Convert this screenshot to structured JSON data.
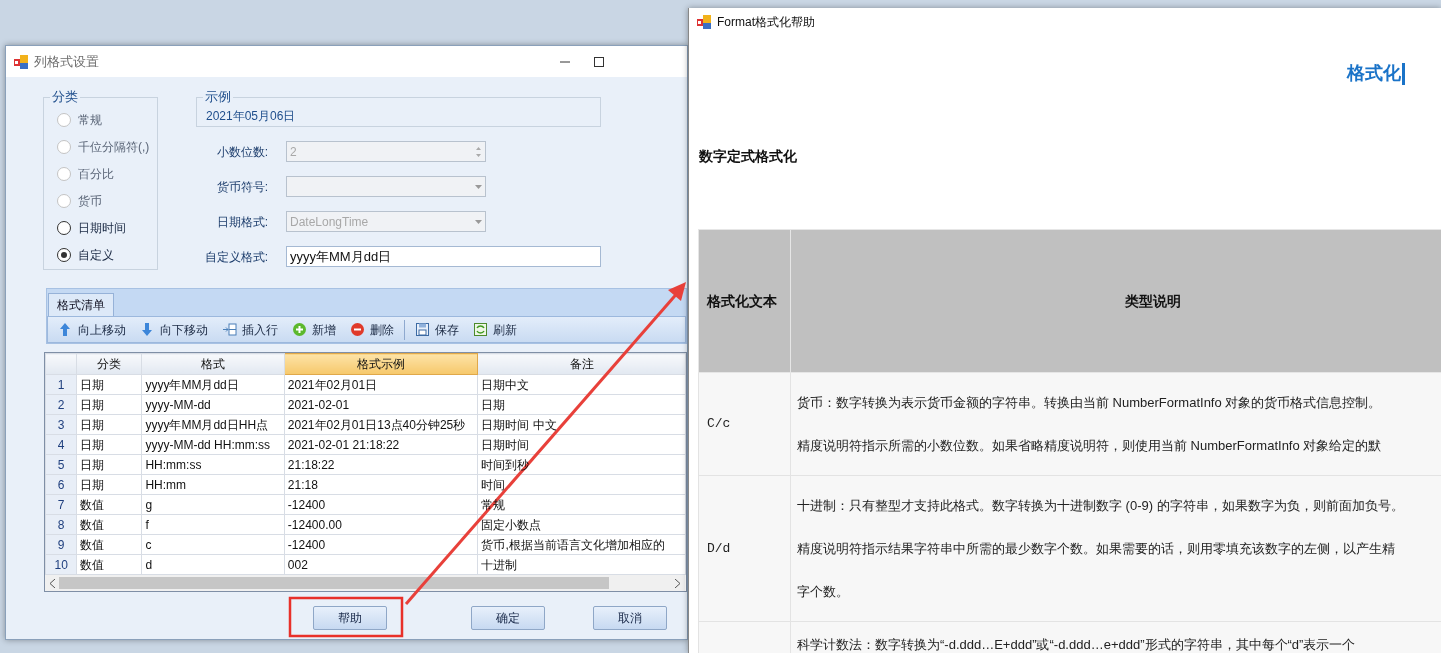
{
  "dialog": {
    "title": "列格式设置",
    "category_group": {
      "label": "分类",
      "options": [
        {
          "label": "常规",
          "selected": false,
          "disabled": true
        },
        {
          "label": "千位分隔符(,)",
          "selected": false,
          "disabled": true
        },
        {
          "label": "百分比",
          "selected": false,
          "disabled": true
        },
        {
          "label": "货币",
          "selected": false,
          "disabled": true
        },
        {
          "label": "日期时间",
          "selected": false,
          "disabled": false
        },
        {
          "label": "自定义",
          "selected": true,
          "disabled": false
        }
      ]
    },
    "example": {
      "label": "示例",
      "value": "2021年05月06日"
    },
    "fields": [
      {
        "kind": "spinner",
        "label": "小数位数:",
        "value": "2",
        "disabled": true
      },
      {
        "kind": "dropdown",
        "label": "货币符号:",
        "disabled": true
      },
      {
        "kind": "dropdown",
        "label": "日期格式:",
        "value": "DateLongTime",
        "disabled": true
      },
      {
        "kind": "text",
        "label": "自定义格式:",
        "value": "yyyy年MM月dd日",
        "disabled": false
      }
    ],
    "tabs": [
      {
        "label": "格式清单",
        "selected": true
      }
    ],
    "toolbar": [
      {
        "kind": "move-up",
        "label": "向上移动",
        "separator_before": false
      },
      {
        "kind": "move-down",
        "label": "向下移动",
        "separator_before": false
      },
      {
        "kind": "insert",
        "label": "插入行",
        "separator_before": false
      },
      {
        "kind": "add",
        "label": "新增",
        "separator_before": false
      },
      {
        "kind": "delete",
        "label": "删除",
        "separator_before": false
      },
      {
        "kind": "save",
        "label": "保存",
        "separator_before": true
      },
      {
        "kind": "refresh",
        "label": "刷新",
        "separator_before": false
      }
    ],
    "grid": {
      "columns": [
        {
          "label": "分类",
          "selected": false
        },
        {
          "label": "格式",
          "selected": false
        },
        {
          "label": "格式示例",
          "selected": true
        },
        {
          "label": "备注",
          "selected": false
        }
      ],
      "rows": [
        {
          "number": "1",
          "cells": [
            "日期",
            "yyyy年MM月dd日",
            "2021年02月01日",
            "日期中文"
          ]
        },
        {
          "number": "2",
          "cells": [
            "日期",
            "yyyy-MM-dd",
            "2021-02-01",
            "日期"
          ]
        },
        {
          "number": "3",
          "cells": [
            "日期",
            "yyyy年MM月dd日HH点",
            "2021年02月01日13点40分钟25秒",
            "日期时间 中文"
          ]
        },
        {
          "number": "4",
          "cells": [
            "日期",
            "yyyy-MM-dd HH:mm:ss",
            "2021-02-01 21:18:22",
            "日期时间"
          ]
        },
        {
          "number": "5",
          "cells": [
            "日期",
            "HH:mm:ss",
            "21:18:22",
            "时间到秒"
          ]
        },
        {
          "number": "6",
          "cells": [
            "日期",
            "HH:mm",
            "21:18",
            "时间"
          ]
        },
        {
          "number": "7",
          "cells": [
            "数值",
            "g",
            "-12400",
            "常规"
          ]
        },
        {
          "number": "8",
          "cells": [
            "数值",
            "f",
            "-12400.00",
            "固定小数点"
          ]
        },
        {
          "number": "9",
          "cells": [
            "数值",
            "c",
            "-12400",
            "货币,根据当前语言文化增加相应的"
          ]
        },
        {
          "number": "10",
          "cells": [
            "数值",
            "d",
            "002",
            "十进制"
          ]
        }
      ]
    },
    "buttons": [
      {
        "label": "帮助"
      },
      {
        "label": "确定"
      },
      {
        "label": "取消"
      }
    ]
  },
  "help_window": {
    "title": "Format格式化帮助",
    "heading": "格式化",
    "section_title": "数字定式格式化",
    "table": {
      "columns": [
        "格式化文本",
        "类型说明"
      ],
      "rows": [
        {
          "code": "C/c",
          "lines": [
            "货币：数字转换为表示货币金额的字符串。转换由当前 NumberFormatInfo 对象的货币格式信息控制。",
            "精度说明符指示所需的小数位数。如果省略精度说明符，则使用当前 NumberFormatInfo 对象给定的默"
          ]
        },
        {
          "code": "D/d",
          "lines": [
            "十进制：只有整型才支持此格式。数字转换为十进制数字 (0-9) 的字符串，如果数字为负，则前面加负号。",
            "精度说明符指示结果字符串中所需的最少数字个数。如果需要的话，则用零填充该数字的左侧，以产生精",
            "字个数。"
          ]
        },
        {
          "code": "",
          "lines": [
            "科学计数法：数字转换为“-d.ddd…E+ddd”或“-d.ddd…e+ddd”形式的字符串，其中每个“d”表示一个"
          ]
        }
      ]
    }
  }
}
